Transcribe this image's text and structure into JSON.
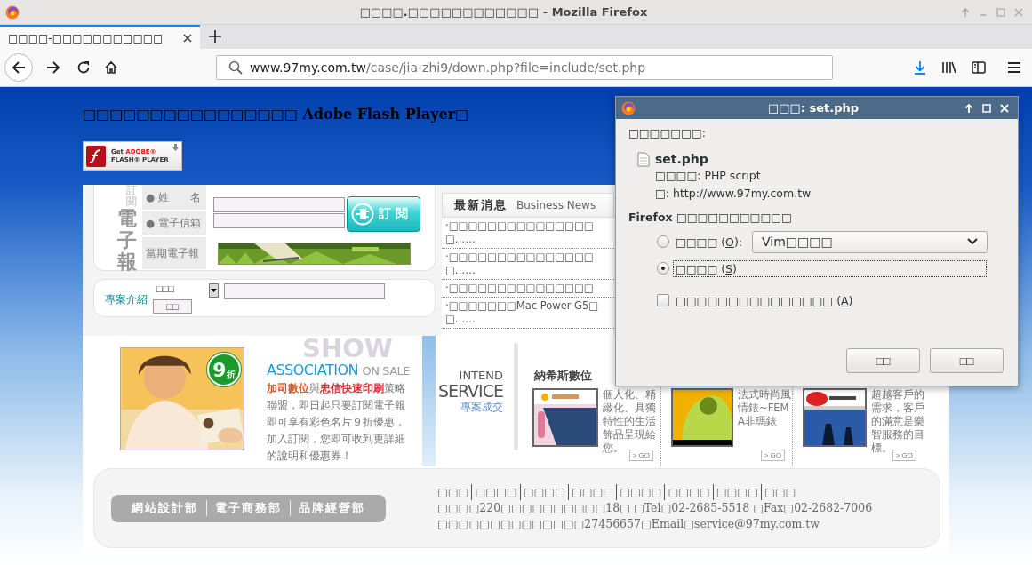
{
  "window": {
    "title": "□□□□.□□□□□□□□□□□□ - Mozilla Firefox"
  },
  "tabs": [
    {
      "label": "□□□□-□□□□□□□□□□□",
      "selected": true
    }
  ],
  "address_bar": {
    "host": "www.97my.com.tw",
    "path": "/case/jia-zhi9/down.php?file=include/set.php"
  },
  "page": {
    "flash_notice": "□□□□□□□□□□□□□□□□ Adobe Flash Player□",
    "flash_badge": {
      "get": "Get ",
      "brand": "ADOBE®",
      "product": "FLASH® PLAYER"
    },
    "subscribe": {
      "title_small": "訂閱",
      "title_big": "電子報",
      "fields": [
        {
          "label": "● 姓　　名"
        },
        {
          "label": "● 電子信箱"
        }
      ],
      "current_label": "當期電子報",
      "button": "訂 閱"
    },
    "project_search": {
      "label": "專案介紹",
      "select": "□□□",
      "button": "□□"
    },
    "news": {
      "title": "最新消息",
      "subtitle": "Business News",
      "items": [
        {
          "text": "·□□□□□□□□□□□□□□□□……"
        },
        {
          "text": "·□□□□□□□□□□□□□□□□……"
        },
        {
          "text": "·□□□□□□□□□□□□□□□"
        },
        {
          "text": "·□□□□□□□Mac Power G5□□……"
        }
      ]
    },
    "association": {
      "watermark": "SHOW",
      "title": "ASSOCIATION",
      "title_suffix": "ON SALE",
      "discount": {
        "number": "9",
        "unit": "折"
      },
      "body": [
        {
          "kind": "brand",
          "text": "加司數位",
          "color": "#c8501e"
        },
        {
          "kind": "plain",
          "text": "與"
        },
        {
          "kind": "brand",
          "text": "忠信快速印刷",
          "color": "#e0202a"
        },
        {
          "kind": "plain",
          "text": "策略聯盟，即日起只要訂閱電子報即可享有彩色名片９折優惠，加入訂閱，您即可收到更詳細的說明和優惠券！"
        }
      ]
    },
    "service": {
      "title_top": "INTEND",
      "title_main": "SERVICE",
      "subtitle": "專案成交",
      "cards": [
        {
          "title": "納希斯數位",
          "text": "個人化、精緻化、具獨特性的生活飾品呈現給您。",
          "go": "> GO"
        },
        {
          "text": "法式時尚風情錶~FEMA非瑪錶",
          "go": "> GO"
        },
        {
          "text": "超越客戶的需求，客戶的滿意是樂智服務的目標。",
          "go": "> GO"
        }
      ]
    },
    "departments": [
      "網站設計部",
      "電子商務部",
      "品牌經營部"
    ],
    "footer": {
      "links": [
        "□□□",
        "□□□□",
        "□□□□",
        "□□□□",
        "□□□□",
        "□□□□",
        "□□□□",
        "□□□"
      ],
      "address": "□□□□220□□□□□□□□□□18□ □Tel□02-2685-5518 □Fax□02-2682-7006",
      "company": "□□□□□□□□□□□□□□27456657□Email□service@97my.com.tw"
    }
  },
  "dialog": {
    "title": "□□□: set.php",
    "intro": "□□□□□□□:",
    "file": {
      "name": "set.php",
      "type": "□□□□: PHP script",
      "from": "□: http://www.97my.com.tw"
    },
    "question": "Firefox □□□□□□□□□□□",
    "options": [
      {
        "kind": "open",
        "before": "□□□□ (",
        "key": "O",
        "after": "):",
        "app": "Vim□□□□",
        "selected": false
      },
      {
        "kind": "save",
        "before": "□□□□ (",
        "key": "S",
        "after": ")",
        "selected": true
      }
    ],
    "remember": {
      "before": "□□□□□□□□□□□□□□□ (",
      "key": "A",
      "after": ")",
      "checked": false
    },
    "buttons": [
      "□□",
      "□□"
    ]
  }
}
